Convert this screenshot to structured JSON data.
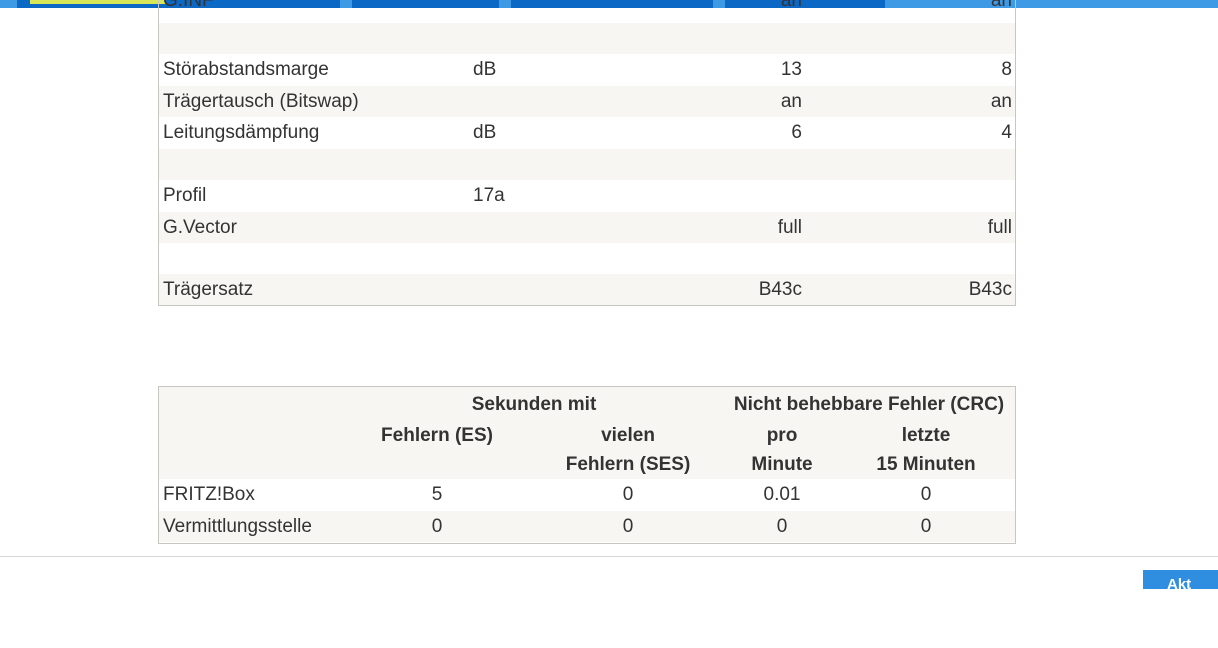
{
  "colors": {
    "tab_bar": "#3f9ae6",
    "tab_active": "#0b68c5",
    "tab_indicator": "#d8e65a",
    "row_shade": "#f7f6f3",
    "table_border": "#c8c6c0",
    "button": "#2f8ee0"
  },
  "line_table": {
    "rows": [
      {
        "label": "G.INF",
        "unit": "",
        "v1": "an",
        "v2": "an",
        "shade": false
      },
      {
        "label": "",
        "unit": "",
        "v1": "",
        "v2": "",
        "shade": true
      },
      {
        "label": "Störabstandsmarge",
        "unit": "dB",
        "v1": "13",
        "v2": "8",
        "shade": false
      },
      {
        "label": "Trägertausch (Bitswap)",
        "unit": "",
        "v1": "an",
        "v2": "an",
        "shade": true
      },
      {
        "label": "Leitungsdämpfung",
        "unit": "dB",
        "v1": "6",
        "v2": "4",
        "shade": false
      },
      {
        "label": "",
        "unit": "",
        "v1": "",
        "v2": "",
        "shade": true
      },
      {
        "label": "Profil",
        "unit": "17a",
        "v1": "",
        "v2": "",
        "shade": false
      },
      {
        "label": "G.Vector",
        "unit": "",
        "v1": "full",
        "v2": "full",
        "shade": true
      },
      {
        "label": "",
        "unit": "",
        "v1": "",
        "v2": "",
        "shade": false
      },
      {
        "label": "Trägersatz",
        "unit": "",
        "v1": "B43c",
        "v2": "B43c",
        "shade": true
      }
    ]
  },
  "error_table": {
    "header": {
      "group1": "Sekunden mit",
      "group2": "Nicht behebbare Fehler (CRC)",
      "col_es": "Fehlern (ES)",
      "col_ses_line1": "vielen",
      "col_ses_line2": "Fehlern (SES)",
      "col_pm_line1": "pro",
      "col_pm_line2": "Minute",
      "col_15_line1": "letzte",
      "col_15_line2": "15 Minuten"
    },
    "rows": [
      {
        "label": "FRITZ!Box",
        "es": "5",
        "ses": "0",
        "per_minute": "0.01",
        "last15": "0"
      },
      {
        "label": "Vermittlungsstelle",
        "es": "0",
        "ses": "0",
        "per_minute": "0",
        "last15": "0"
      }
    ]
  },
  "footer": {
    "button_label": "Akt"
  }
}
